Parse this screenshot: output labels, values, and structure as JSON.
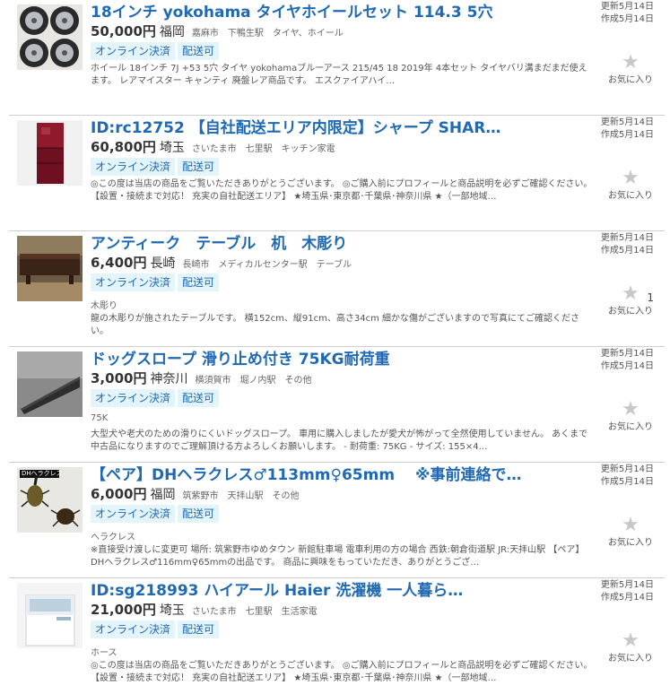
{
  "labels": {
    "updated_prefix": "更新",
    "created_prefix": "作成",
    "favorite": "お気に入り"
  },
  "items": [
    {
      "title": "18インチ yokohama タイヤホイールセット 114.3 5穴",
      "price": "50,000円",
      "prefecture": "福岡",
      "location": "嘉麻市　下鴨生駅　タイヤ、ホイール",
      "badges": [
        "オンライン決済",
        "配送可"
      ],
      "tag": "",
      "description": "ホイール 18インチ 7J +53 5穴 タイヤ yokohamaブルーアース 215/45 18 2019年 4本セット タイヤバリ溝まだまだ使えます。 レアマイスター キャンティ 廃盤レア商品です。 エスクァイアハイ…",
      "updated": "更新5月14日",
      "created": "作成5月14日",
      "favorite_count": "",
      "image": "wheels-photo"
    },
    {
      "title": "ID:rc12752 【自社配送エリア内限定】シャープ SHAR…",
      "price": "60,800円",
      "prefecture": "埼玉",
      "location": "さいたま市　七里駅　キッチン家電",
      "badges": [
        "オンライン決済",
        "配送可"
      ],
      "tag": "",
      "description": "◎この度は当店の商品をご覧いただきありがとうございます。 ◎ご購入前にプロフィールと商品説明を必ずご確認ください。【設置・接続まで対応！ 充実の自社配送エリア】 ★埼玉県･東京都･千葉県･神奈川県 ★（一部地域…",
      "updated": "更新5月14日",
      "created": "作成5月14日",
      "favorite_count": "",
      "image": "fridge-photo"
    },
    {
      "title": "アンティーク　テーブル　机　木彫り",
      "price": "6,400円",
      "prefecture": "長崎",
      "location": "長崎市　メディカルセンター駅　テーブル",
      "badges": [
        "オンライン決済",
        "配送可"
      ],
      "tag": "木彫り",
      "description": "龍の木彫りが施されたテーブルです。 横152cm、縦91cm、高さ34cm 細かな傷がございますので写真にてご確認ください。",
      "updated": "更新5月14日",
      "created": "作成5月14日",
      "favorite_count": "1",
      "image": "table-photo"
    },
    {
      "title": "ドッグスロープ 滑り止め付き 75KG耐荷重",
      "price": "3,000円",
      "prefecture": "神奈川",
      "location": "横須賀市　堀ノ内駅　その他",
      "badges": [
        "オンライン決済",
        "配送可"
      ],
      "tag": "75K",
      "description": "大型犬や老犬のための滑りにくいドッグスロープ。 車用に購入しましたが愛犬が怖がって全然使用していません。 あくまで中古品になりますのでご理解頂ける方よろしくお願いします。 - 耐荷重: 75KG - サイズ: 155×4…",
      "updated": "更新5月14日",
      "created": "作成5月14日",
      "favorite_count": "",
      "image": "slope-photo"
    },
    {
      "title": "【ペア】DHヘラクレス♂113mm♀65mm　 ※事前連絡で…",
      "price": "6,000円",
      "prefecture": "福岡",
      "location": "筑紫野市　天拝山駅　その他",
      "badges": [
        "オンライン決済",
        "配送可"
      ],
      "tag": "ヘラクレス",
      "description": "※直接受け渡しに変更可 場所: 筑紫野市ゆめタウン 新館駐車場 電車利用の方の場合 西鉄:朝倉街道駅 JR:天拝山駅 【ペア】DHヘラクレス♂116mm♀65mmの出品です。 商品に興味をもっていただき、ありがとうござ…",
      "updated": "更新5月14日",
      "created": "作成5月14日",
      "favorite_count": "",
      "image": "beetle-photo",
      "image_caption": "DHヘラクレス"
    },
    {
      "title": "ID:sg218993 ハイアール Haier 洗濯機 一人暮ら…",
      "price": "21,000円",
      "prefecture": "埼玉",
      "location": "さいたま市　七里駅　生活家電",
      "badges": [
        "オンライン決済",
        "配送可"
      ],
      "tag": "ホース",
      "description": "◎この度は当店の商品をご覧いただきありがとうございます。 ◎ご購入前にプロフィールと商品説明を必ずご確認ください。【設置・接続まで対応！ 充実の自社配送エリア】 ★埼玉県･東京都･千葉県･神奈川県 ★（一部地域…",
      "updated": "更新5月14日",
      "created": "作成5月14日",
      "favorite_count": "",
      "image": "washer-photo"
    }
  ]
}
